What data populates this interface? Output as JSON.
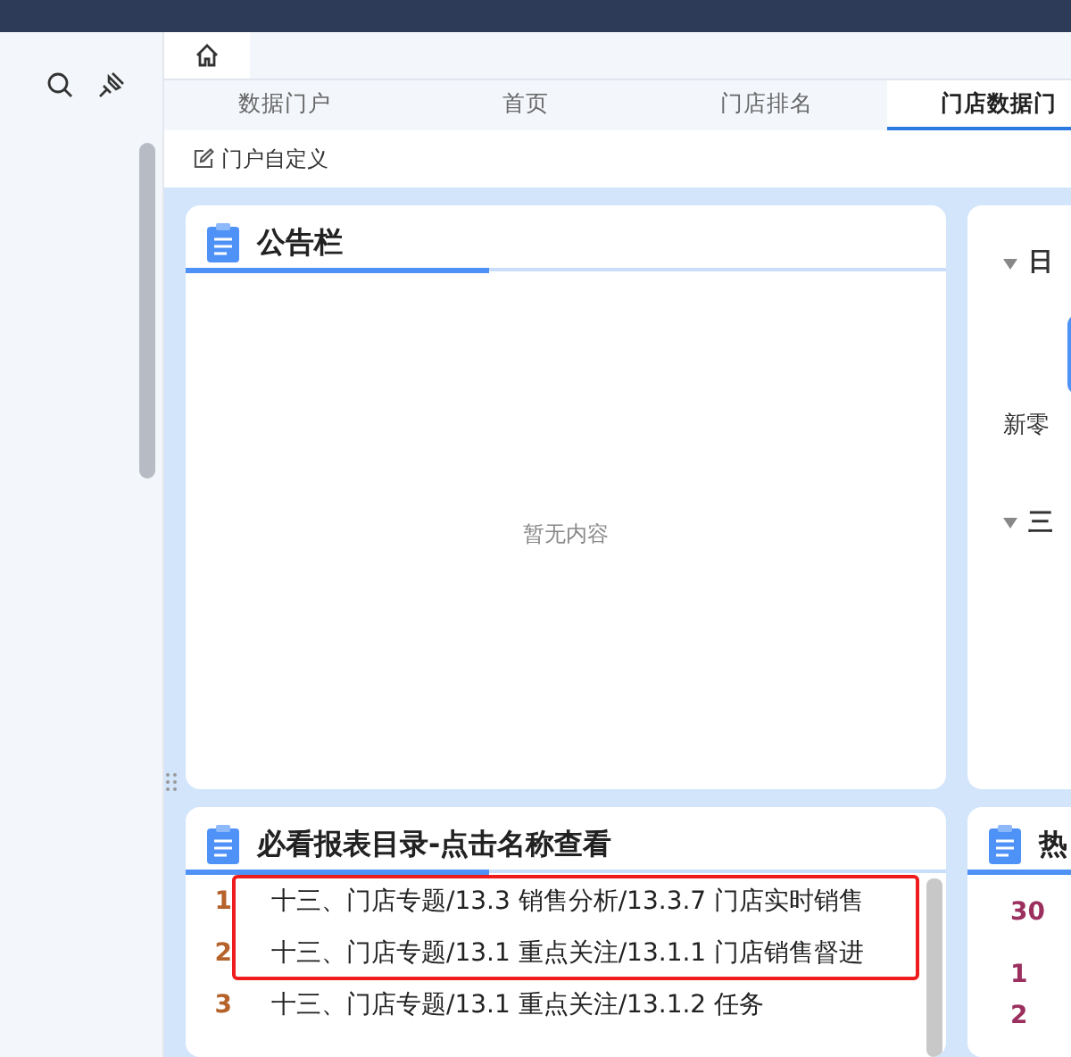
{
  "tabs": [
    {
      "label": "数据门户",
      "selected": false
    },
    {
      "label": "首页",
      "selected": false
    },
    {
      "label": "门店排名",
      "selected": false
    },
    {
      "label": "门店数据门",
      "selected": true
    }
  ],
  "toolbar": {
    "label": "门户自定义"
  },
  "notice_card": {
    "title": "公告栏",
    "empty_text": "暂无内容"
  },
  "side_card": {
    "groups": [
      {
        "title": "日",
        "expanded": true,
        "tile_label": "新零"
      },
      {
        "title": "三",
        "expanded": true
      }
    ]
  },
  "reports_card": {
    "title": "必看报表目录-点击名称查看",
    "highlight_frame": true,
    "rows": [
      {
        "index": "1",
        "text": "十三、门店专题/13.3 销售分析/13.3.7 门店实时销售"
      },
      {
        "index": "2",
        "text": "十三、门店专题/13.1 重点关注/13.1.1 门店销售督进"
      },
      {
        "index": "3",
        "text": "十三、门店专题/13.1 重点关注/13.1.2 任务"
      }
    ]
  },
  "hot_card": {
    "title": "热",
    "values": [
      "30",
      "1",
      "2"
    ]
  }
}
